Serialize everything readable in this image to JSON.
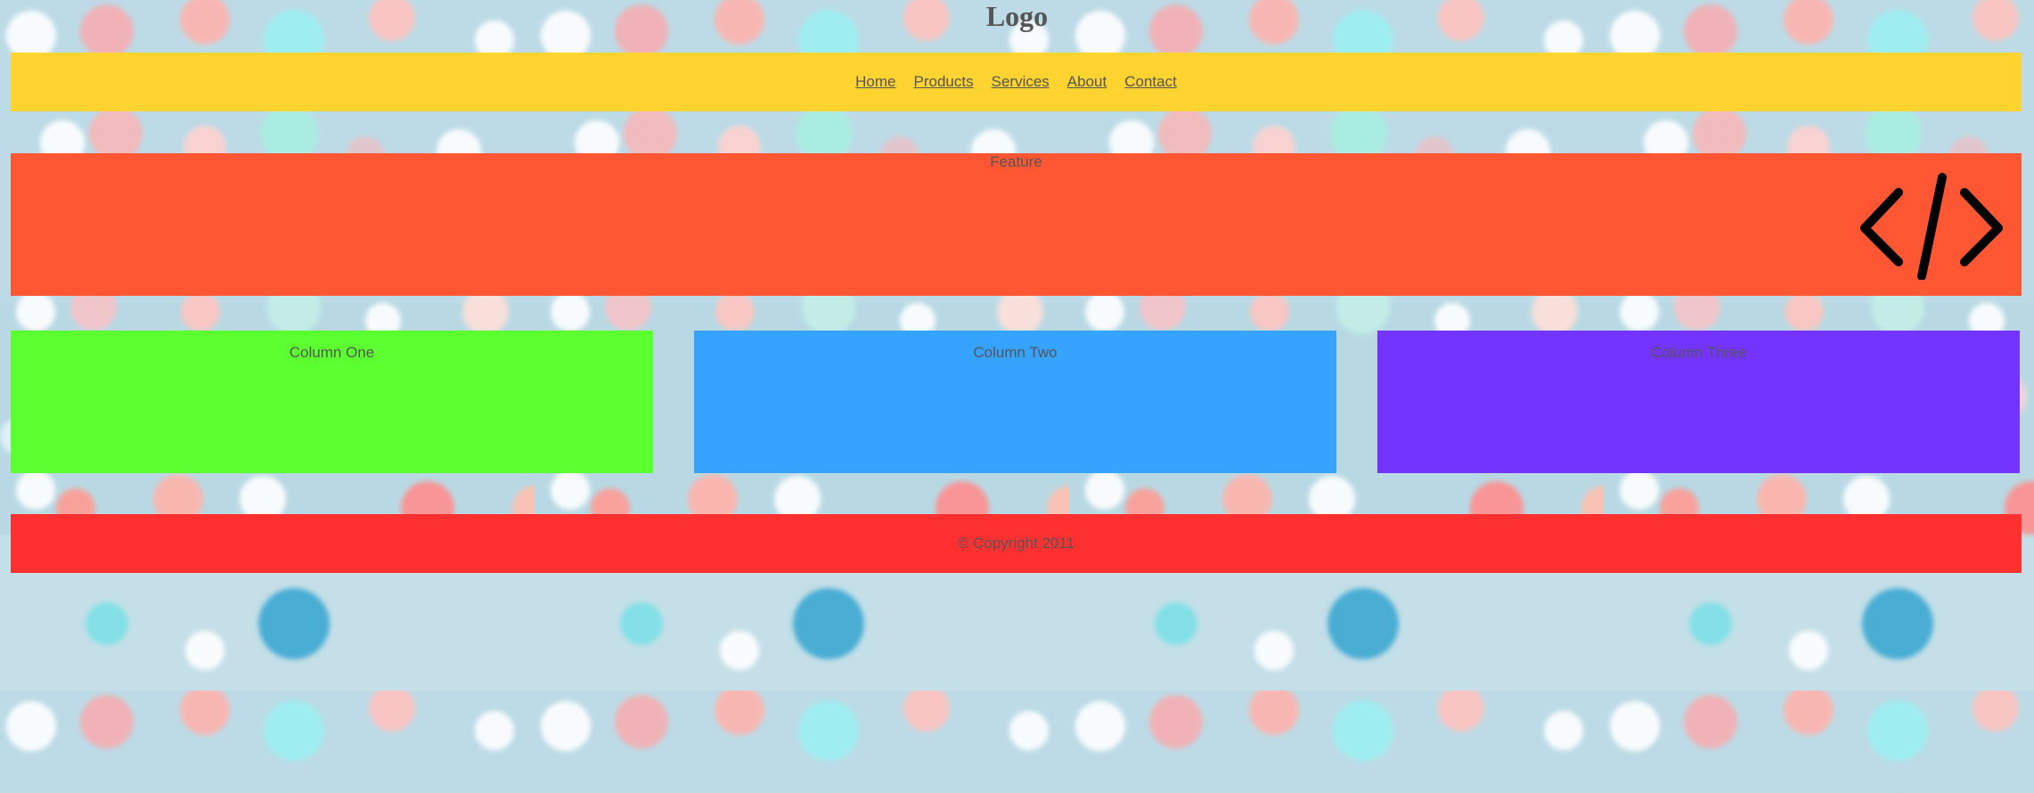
{
  "logo": "Logo",
  "nav": {
    "items": [
      "Home",
      "Products",
      "Services",
      "About",
      "Contact"
    ]
  },
  "feature": {
    "label": "Feature",
    "icon": "code-icon"
  },
  "columns": [
    {
      "label": "Column One",
      "color": "#5cff2f"
    },
    {
      "label": "Column Two",
      "color": "#36a4ff"
    },
    {
      "label": "Column Three",
      "color": "#7434ff"
    }
  ],
  "footer": {
    "text": "© Copyright 2011"
  },
  "colors": {
    "nav": "#ffd330",
    "feature": "#ff5733",
    "footer": "#ff3030",
    "text": "#555555"
  }
}
